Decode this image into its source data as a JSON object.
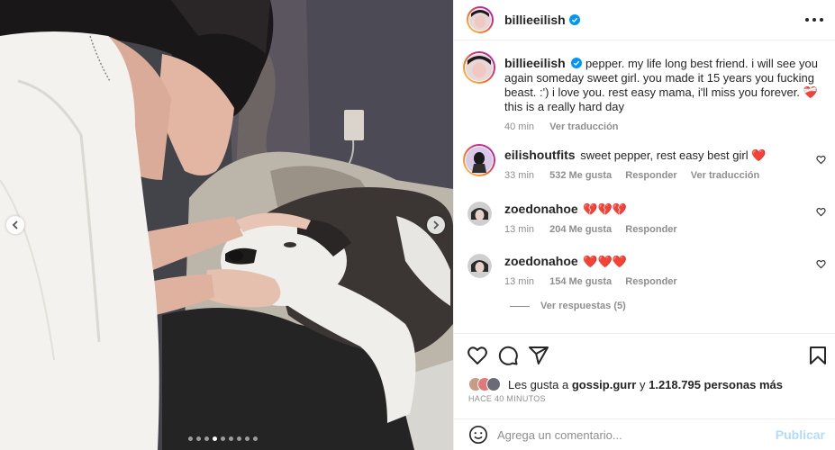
{
  "post": {
    "photo_alt": "woman kissing an old dog lying on a bed",
    "carousel": {
      "dot_count": 9,
      "active_index": 3
    },
    "icons": {
      "prev": "chevron-left-icon",
      "next": "chevron-right-icon"
    }
  },
  "header": {
    "username": "billieeilish",
    "verified": true,
    "more_icon": "ellipsis-icon"
  },
  "caption": {
    "username": "billieeilish",
    "text": "pepper. my life long best friend. i will see you again someday sweet girl. you made it 15 years you fucking beast. :') i love you. rest easy mama, i'll miss you forever.",
    "emoji": "❤️‍🩹",
    "text_end": "this is a really hard day",
    "time": "40 min",
    "translate": "Ver traducción"
  },
  "comments": [
    {
      "username": "eilishoutfits",
      "text": "sweet pepper, rest easy best girl",
      "emoji": "❤️",
      "time": "33 min",
      "likes": "532 Me gusta",
      "reply": "Responder",
      "translate": "Ver traducción"
    },
    {
      "username": "zoedonahoe",
      "text": "",
      "emoji": "💔💔💔",
      "time": "13 min",
      "likes": "204 Me gusta",
      "reply": "Responder"
    },
    {
      "username": "zoedonahoe",
      "text": "",
      "emoji": "❤️❤️❤️",
      "time": "13 min",
      "likes": "154 Me gusta",
      "reply": "Responder"
    }
  ],
  "view_replies": "Ver respuestas (5)",
  "actions": {
    "icons": [
      "heart-icon",
      "comment-icon",
      "share-icon",
      "bookmark-icon"
    ]
  },
  "likes": {
    "prefix": "Les gusta a",
    "user": "gossip.gurr",
    "conj": "y",
    "count": "1.218.795 personas más"
  },
  "posted_ago": "HACE 40 MINUTOS",
  "add_comment": {
    "placeholder": "Agrega un comentario...",
    "post_label": "Publicar"
  },
  "colors": {
    "verified": "#0095f6",
    "heart": "#ed4956",
    "publish_disabled": "#b3dbff",
    "secondary_text": "#8e8e8e"
  }
}
